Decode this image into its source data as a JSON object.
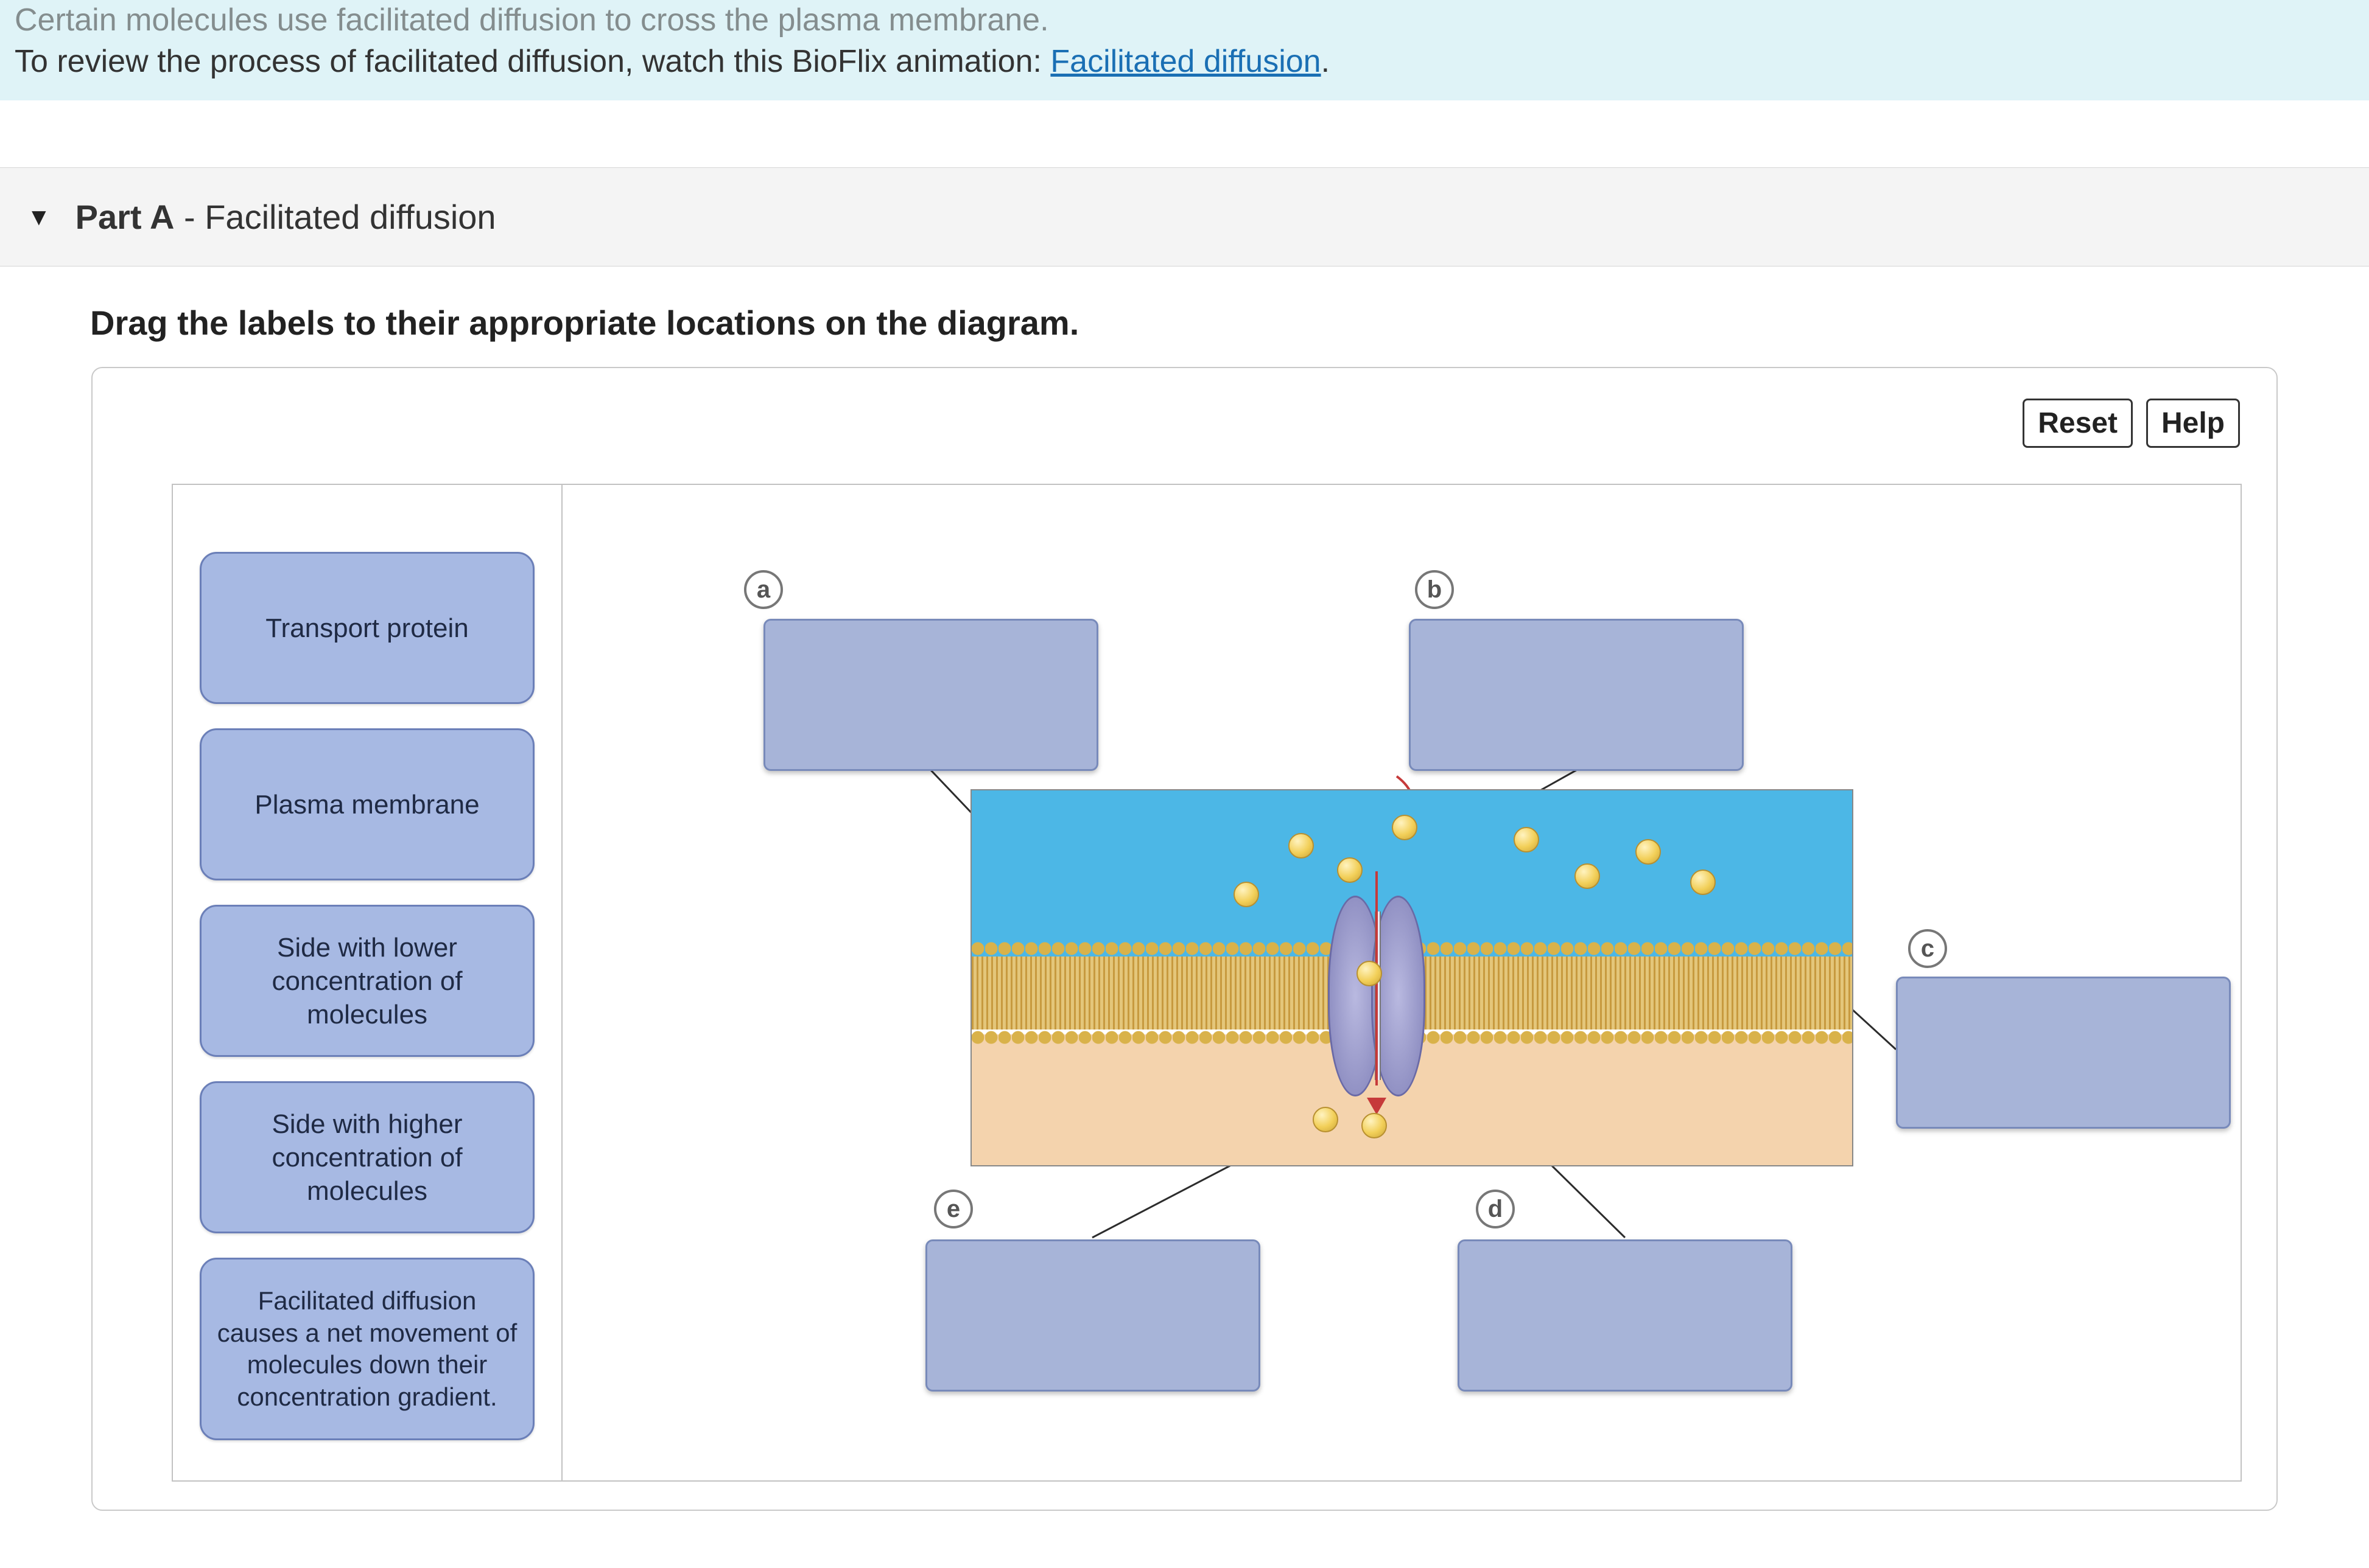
{
  "intro": {
    "line1": "Certain molecules use facilitated diffusion to cross the plasma membrane.",
    "line2_prefix": "To review the process of facilitated diffusion, watch this BioFlix animation: ",
    "link_text": "Facilitated diffusion",
    "line2_suffix": "."
  },
  "part": {
    "label": "Part A",
    "separator": " - ",
    "title": "Facilitated diffusion"
  },
  "instruction": "Drag the labels to their appropriate locations on the diagram.",
  "buttons": {
    "reset": "Reset",
    "help": "Help"
  },
  "labels": {
    "items": [
      "Transport protein",
      "Plasma membrane",
      "Side with lower concentration of molecules",
      "Side with higher concentration of molecules",
      "Facilitated diffusion causes a net movement of molecules down their concentration gradient."
    ]
  },
  "slots": {
    "a": "a",
    "b": "b",
    "c": "c",
    "d": "d",
    "e": "e"
  }
}
